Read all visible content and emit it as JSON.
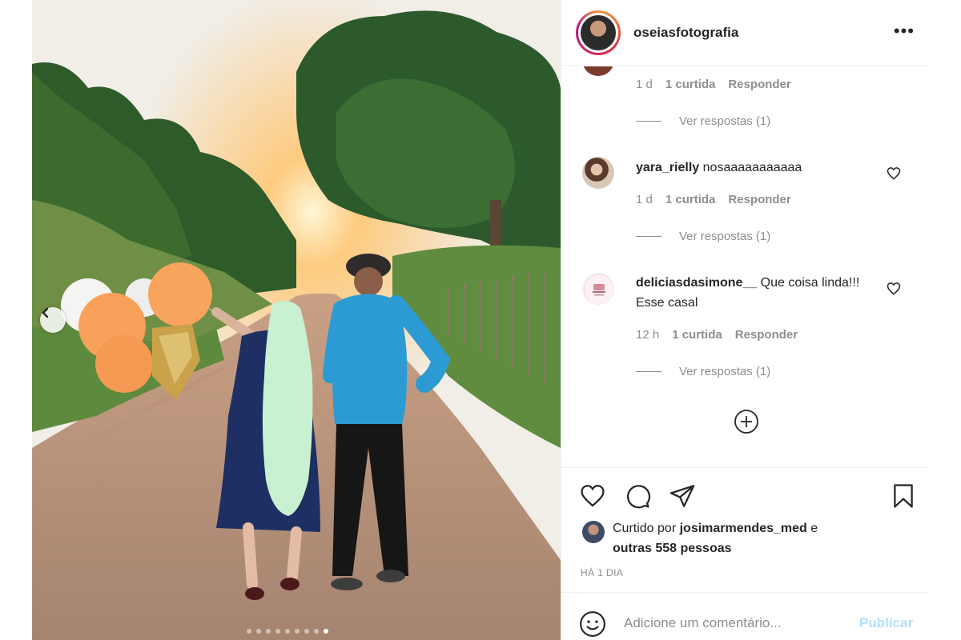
{
  "post": {
    "username": "oseiasfotografia",
    "more_icon": "more-horizontal-icon",
    "carousel": {
      "slide_count": 9,
      "active_index": 8
    }
  },
  "comments": {
    "first": {
      "time": "1 d",
      "likes": "1 curtida",
      "reply": "Responder",
      "view_replies": "Ver respostas (1)"
    },
    "items": [
      {
        "username": "yara_rielly",
        "text": "nosaaaaaaaaaaa",
        "time": "1 d",
        "likes": "1 curtida",
        "reply": "Responder",
        "view_replies": "Ver respostas (1)"
      },
      {
        "username": "deliciasdasimone__",
        "text": "Que coisa linda!!! Esse casal",
        "time": "12 h",
        "likes": "1 curtida",
        "reply": "Responder",
        "view_replies": "Ver respostas (1)"
      }
    ]
  },
  "likes": {
    "prefix": "Curtido por",
    "user": "josimarmendes_med",
    "suffix": "e",
    "others": "outras 558 pessoas"
  },
  "timestamp": "HÁ 1 DIA",
  "add_comment": {
    "placeholder": "Adicione um comentário...",
    "publish": "Publicar"
  },
  "colors": {
    "link_blue_disabled": "#b2dffc",
    "secondary_text": "#8e8e8e",
    "primary_text": "#262626"
  }
}
